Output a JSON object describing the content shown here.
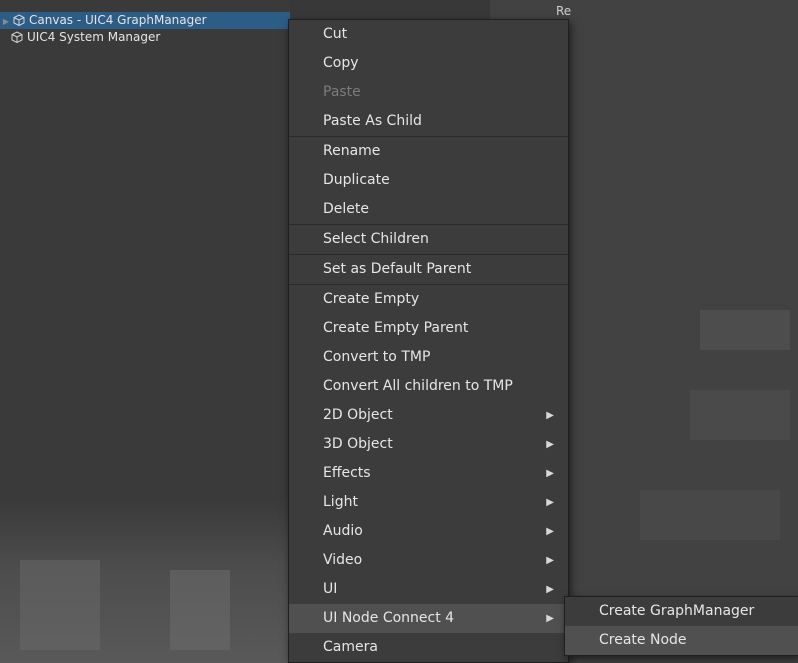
{
  "hierarchy": {
    "rows": [
      {
        "label": "Canvas - UIC4 GraphManager",
        "selected": true,
        "has_arrow": true
      },
      {
        "label": "UIC4 System Manager",
        "selected": false,
        "has_arrow": false
      }
    ],
    "fragment_text": "Re"
  },
  "context_menu": {
    "items": [
      {
        "label": "Cut"
      },
      {
        "label": "Copy"
      },
      {
        "label": "Paste",
        "disabled": true
      },
      {
        "label": "Paste As Child"
      },
      {
        "label": "Rename"
      },
      {
        "label": "Duplicate"
      },
      {
        "label": "Delete"
      },
      {
        "label": "Select Children"
      },
      {
        "label": "Set as Default Parent"
      },
      {
        "label": "Create Empty"
      },
      {
        "label": "Create Empty Parent"
      },
      {
        "label": "Convert to TMP"
      },
      {
        "label": "Convert All children to TMP"
      },
      {
        "label": "2D Object",
        "submenu": true
      },
      {
        "label": "3D Object",
        "submenu": true
      },
      {
        "label": "Effects",
        "submenu": true
      },
      {
        "label": "Light",
        "submenu": true
      },
      {
        "label": "Audio",
        "submenu": true
      },
      {
        "label": "Video",
        "submenu": true
      },
      {
        "label": "UI",
        "submenu": true
      },
      {
        "label": "UI Node Connect 4",
        "submenu": true,
        "highlighted": true
      },
      {
        "label": "Camera"
      }
    ]
  },
  "submenu": {
    "items": [
      {
        "label": "Create GraphManager"
      },
      {
        "label": "Create Node",
        "highlighted": true
      }
    ]
  },
  "colors": {
    "selection": "#2c5d87",
    "menu_bg": "#3c3c3c",
    "menu_highlight": "#505050"
  }
}
